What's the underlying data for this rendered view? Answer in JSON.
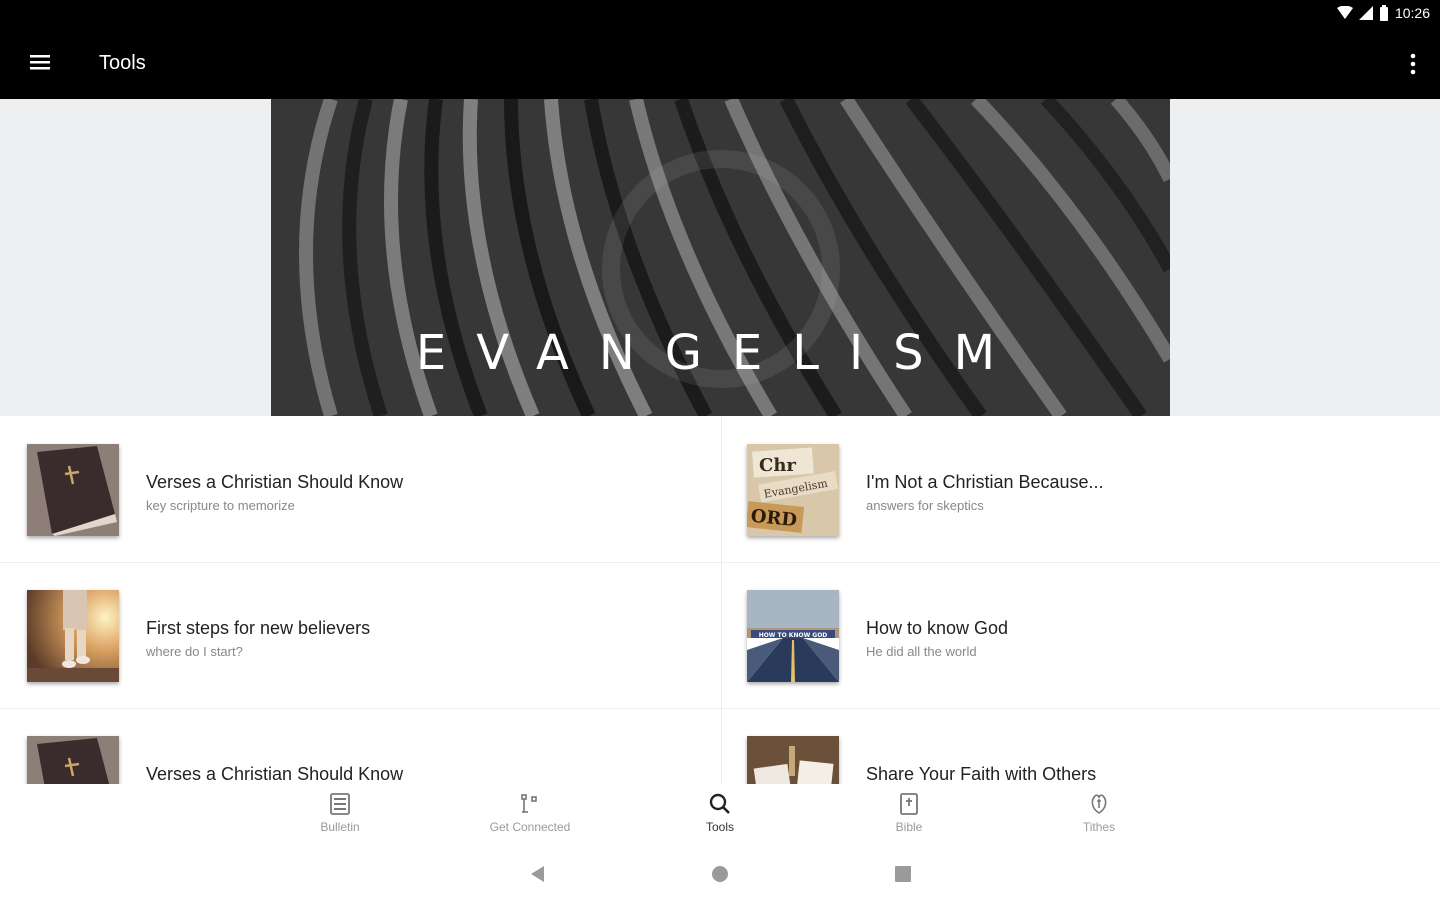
{
  "status_bar": {
    "time": "10:26"
  },
  "app_bar": {
    "title": "Tools"
  },
  "hero": {
    "title": "EVANGELISM"
  },
  "items": [
    {
      "title": "Verses a Christian Should Know",
      "subtitle": "key scripture to memorize",
      "thumb": "bible-book"
    },
    {
      "title": "I'm Not a Christian Because...",
      "subtitle": "answers for skeptics",
      "thumb": "christ-evangelism-words"
    },
    {
      "title": "First steps for new believers",
      "subtitle": "where do I start?",
      "thumb": "child-walking"
    },
    {
      "title": "How to know God",
      "subtitle": "He did all the world",
      "thumb": "road-sign"
    },
    {
      "title": "Verses a Christian Should Know",
      "subtitle": "",
      "thumb": "bible-book"
    },
    {
      "title": "Share Your Faith with Others",
      "subtitle": "",
      "thumb": "cards"
    }
  ],
  "bottom_nav": {
    "items": [
      {
        "label": "Bulletin",
        "icon": "bulletin-icon"
      },
      {
        "label": "Get Connected",
        "icon": "connected-icon"
      },
      {
        "label": "Tools",
        "icon": "search-icon",
        "active": true
      },
      {
        "label": "Bible",
        "icon": "bible-icon"
      },
      {
        "label": "Tithes",
        "icon": "tithes-icon"
      }
    ]
  }
}
